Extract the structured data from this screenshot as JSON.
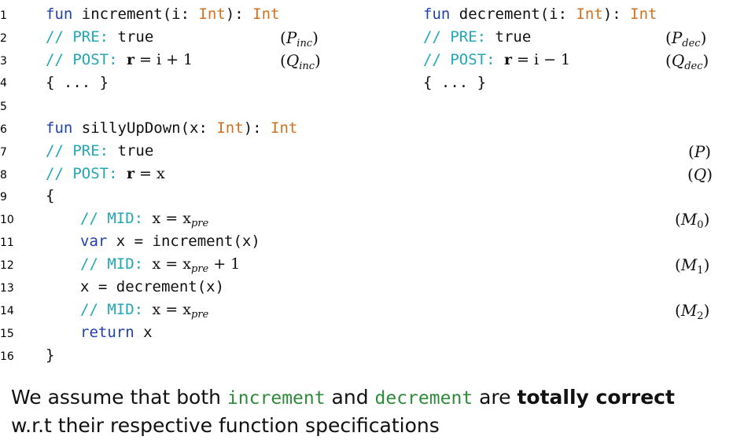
{
  "line_numbers": [
    "1",
    "2",
    "3",
    "4",
    "5",
    "6",
    "7",
    "8",
    "9",
    "10",
    "11",
    "12",
    "13",
    "14",
    "15",
    "16"
  ],
  "inc": {
    "kw_fun": "fun",
    "sig_name": " increment(i: ",
    "type1": "Int",
    "sig_close": "): ",
    "type2": "Int",
    "pre_comment": "// PRE: ",
    "pre_value": "true",
    "post_comment": "// POST: ",
    "post_lhs": "r",
    "post_eq": " = ",
    "post_rhs": "i + 1",
    "body": "{ ... }",
    "label_pre_main": "P",
    "label_pre_sub": "inc",
    "label_post_main": "Q",
    "label_post_sub": "inc"
  },
  "dec": {
    "kw_fun": "fun",
    "sig_name": " decrement(i: ",
    "type1": "Int",
    "sig_close": "): ",
    "type2": "Int",
    "pre_comment": "// PRE: ",
    "pre_value": "true",
    "post_comment": "// POST: ",
    "post_lhs": "r",
    "post_eq": " = ",
    "post_rhs": "i − 1",
    "body": "{ ... }",
    "label_pre_main": "P",
    "label_pre_sub": "dec",
    "label_post_main": "Q",
    "label_post_sub": "dec"
  },
  "silly": {
    "kw_fun": "fun",
    "sig_name": " sillyUpDown(x: ",
    "type1": "Int",
    "sig_close": "): ",
    "type2": "Int",
    "pre_comment": "// PRE: ",
    "pre_value": "true",
    "post_comment": "// POST: ",
    "post_lhs": "r",
    "post_eq": " = ",
    "post_rhs": "x",
    "open_brace": "{",
    "mid0_comment": "// MID: ",
    "mid0_lhs": "x = x",
    "mid0_sub": "pre",
    "mid0_rest": "",
    "var_kw": "var",
    "var_rest": " x = increment(x)",
    "mid1_comment": "// MID: ",
    "mid1_lhs": "x = x",
    "mid1_sub": "pre",
    "mid1_rest": " + 1",
    "assign": "x = decrement(x)",
    "mid2_comment": "// MID: ",
    "mid2_lhs": "x = x",
    "mid2_sub": "pre",
    "mid2_rest": "",
    "return_kw": "return",
    "return_rest": " x",
    "close_brace": "}",
    "label_P": "P",
    "label_Q": "Q",
    "label_M0_main": "M",
    "label_M0_sub": "0",
    "label_M1_main": "M",
    "label_M1_sub": "1",
    "label_M2_main": "M",
    "label_M2_sub": "2"
  },
  "prose": {
    "line1_a": "We assume that both ",
    "fn1": "increment",
    "line1_b": " and ",
    "fn2": "decrement",
    "line1_c": " are ",
    "bold": "totally correct",
    "line2": "w.r.t their respective function specifications"
  },
  "colors": {
    "keyword": "#1f3fb4",
    "type": "#d0701e",
    "comment": "#22a7b7",
    "function_name_prose": "#2e8b3a"
  }
}
